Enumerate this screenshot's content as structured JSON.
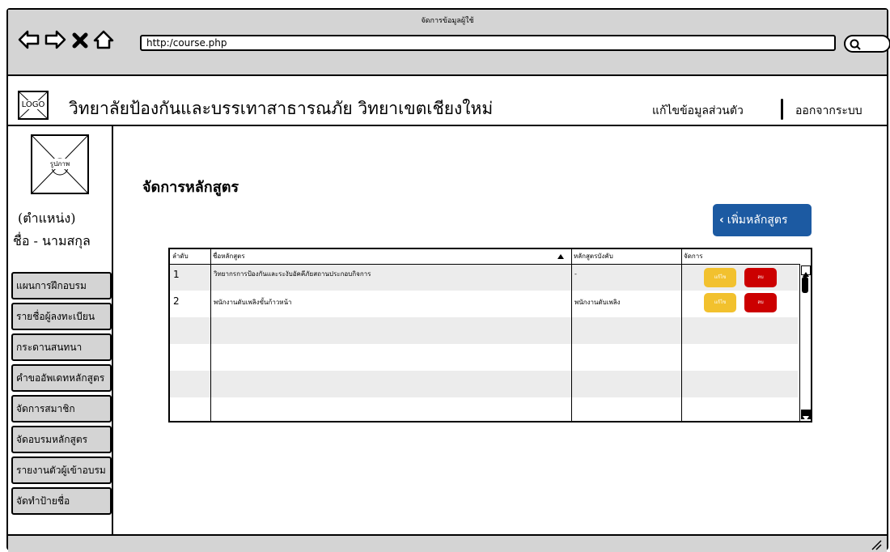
{
  "window": {
    "title": "จัดการข้อมูลผู้ใช้",
    "url": "http:/course.php"
  },
  "header": {
    "logo_text": "LOGO",
    "college_name": "วิทยาลัยป้องกันและบรรเทาสาธารณภัย วิทยาเขตเชียงใหม่",
    "edit_profile": "แก้ไขข้อมูลส่วนตัว",
    "logout": "ออกจากระบบ"
  },
  "sidebar": {
    "image_label": "รูปภาพ",
    "position": "(ตำแหน่ง)",
    "name": "ชื่อ - นามสกุล",
    "items": [
      {
        "label": "แผนการฝึกอบรม"
      },
      {
        "label": "รายชื่อผู้ลงทะเบียน"
      },
      {
        "label": "กระดานสนทนา"
      },
      {
        "label": "คำขออัพเดทหลักสูตร"
      },
      {
        "label": "จัดการสมาชิก"
      },
      {
        "label": "จัดอบรมหลักสูตร"
      },
      {
        "label": "รายงานตัวผู้เข้าอบรม"
      },
      {
        "label": "จัดทำป้ายชื่อ"
      }
    ]
  },
  "main": {
    "title": "จัดการหลักสูตร",
    "add_button": "เพิ่มหลักสูตร",
    "table": {
      "headers": {
        "order": "ลำดับ",
        "course_name": "ชื่อหลักสูตร",
        "prerequisite": "หลักสูตรบังคับ",
        "manage": "จัดการ"
      },
      "rows": [
        {
          "order": "1",
          "course_name": "วิทยากรการป้องกันและระงับอัคคีภัยสถานประกอบกิจการ",
          "prerequisite": "-",
          "edit": "แก้ไข",
          "delete": "ลบ"
        },
        {
          "order": "2",
          "course_name": "พนักงานดับเพลิงขั้นก้าวหน้า",
          "prerequisite": "พนักงานดับเพลิง",
          "edit": "แก้ไข",
          "delete": "ลบ"
        }
      ]
    }
  }
}
